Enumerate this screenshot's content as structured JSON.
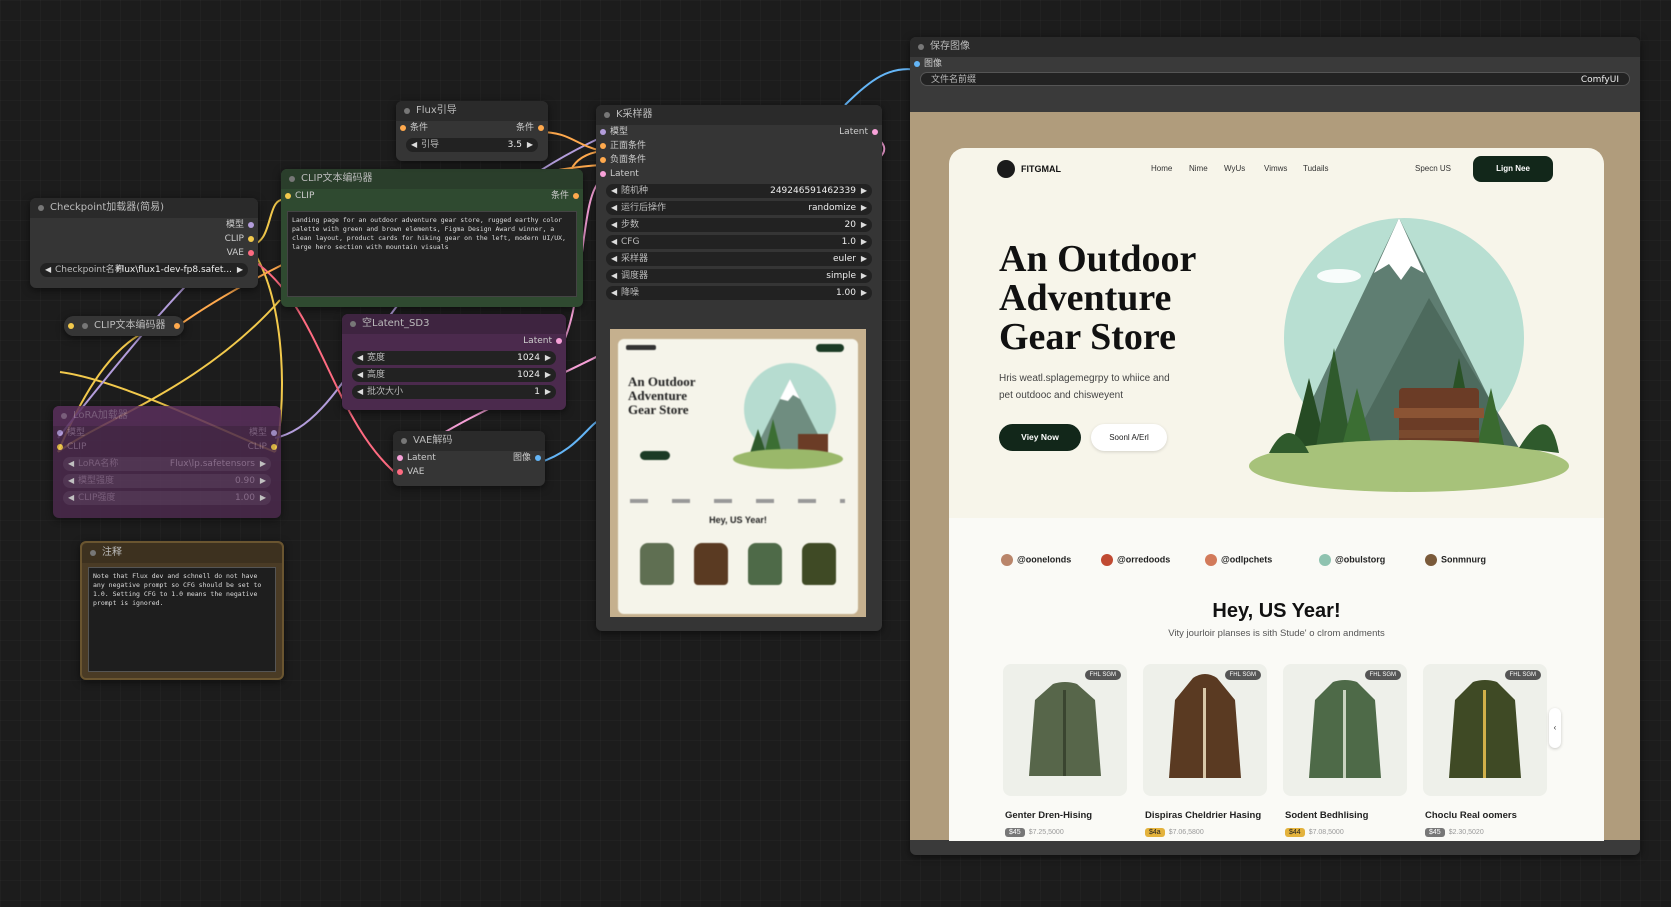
{
  "colors": {
    "clip_green": "#2f4a30",
    "purple": "#4b2a4d",
    "note_brown": "#4a3b25",
    "canvas": "#1c1c1c",
    "clip_wire": "#f2c94c",
    "model_wire": "#b39ddb",
    "vae_wire": "#ff6b81",
    "cond_wire": "#ffa94d",
    "image_wire": "#64b5f6",
    "latent_wire": "#f7a1d8"
  },
  "nodes": {
    "checkpoint": {
      "title": "Checkpoint加载器(简易)",
      "outputs": [
        "模型",
        "CLIP",
        "VAE"
      ],
      "widget_label": "Checkpoint名称",
      "widget_value": "Flux\\flux1-dev-fp8.safet..."
    },
    "clip_neg": {
      "title": "CLIP文本编码器"
    },
    "lora": {
      "title": "LoRA加载器",
      "inputs": [
        "模型",
        "CLIP"
      ],
      "outputs": [
        "模型",
        "CLIP"
      ],
      "widgets": [
        {
          "label": "LoRA名称",
          "value": "Flux\\lp.safetensors"
        },
        {
          "label": "模型强度",
          "value": "0.90"
        },
        {
          "label": "CLIP强度",
          "value": "1.00"
        }
      ]
    },
    "note": {
      "title": "注释",
      "text": "Note that Flux dev and schnell do not have any negative prompt so CFG should be set to 1.0. Setting CFG to 1.0 means the negative prompt is ignored."
    },
    "clip_pos": {
      "title": "CLIP文本编码器",
      "input": "CLIP",
      "output": "条件",
      "prompt": "Landing page for an outdoor adventure gear store, rugged earthy color palette with green and brown elements, Figma Design Award winner, a clean layout, product cards for hiking gear on the left, modern UI/UX, large hero section with mountain visuals"
    },
    "flux_guide": {
      "title": "Flux引导",
      "input": "条件",
      "output": "条件",
      "widget_label": "引导",
      "widget_value": "3.5"
    },
    "empty_latent": {
      "title": "空Latent_SD3",
      "output": "Latent",
      "widgets": [
        {
          "label": "宽度",
          "value": "1024"
        },
        {
          "label": "高度",
          "value": "1024"
        },
        {
          "label": "批次大小",
          "value": "1"
        }
      ]
    },
    "vae_decode": {
      "title": "VAE解码",
      "inputs": [
        "Latent",
        "VAE"
      ],
      "output": "图像"
    },
    "ksampler": {
      "title": "K采样器",
      "inputs": [
        "模型",
        "正面条件",
        "负面条件",
        "Latent"
      ],
      "output": "Latent",
      "widgets": [
        {
          "label": "随机种",
          "value": "249246591462339"
        },
        {
          "label": "运行后操作",
          "value": "randomize"
        },
        {
          "label": "步数",
          "value": "20"
        },
        {
          "label": "CFG",
          "value": "1.0"
        },
        {
          "label": "采样器",
          "value": "euler"
        },
        {
          "label": "调度器",
          "value": "simple"
        },
        {
          "label": "降噪",
          "value": "1.00"
        }
      ]
    },
    "save": {
      "title": "保存图像",
      "input": "图像",
      "widget_label": "文件名前缀",
      "widget_value": "ComfyUI"
    }
  },
  "site": {
    "logo": "FITGMAL",
    "nav": [
      "Home",
      "Nime",
      "WyUs",
      "Vimws",
      "Tudails"
    ],
    "nav_right": "Specn US",
    "cta_button": "Lign Nee",
    "hero_title": [
      "An Outdoor",
      "Adventure",
      "Gear Store"
    ],
    "hero_sub": [
      "Hris weatl.splagemegrpy to whiice and",
      "pet outdooc and chisweyent"
    ],
    "btn_primary": "Viey Now",
    "btn_secondary": "Soonl A/Erl",
    "socials": [
      "@oonelonds",
      "@orredoods",
      "@odlpchets",
      "@obulstorg",
      "Sonmnurg"
    ],
    "section_title": "Hey, US Year!",
    "section_sub": "Vity jourloir planses is sith Stude' o clrom andments",
    "products": [
      {
        "badge": "FHL SGM",
        "name": "Genter Dren-Hising",
        "price": "$45",
        "old": "$7.25,5000"
      },
      {
        "badge": "FHL SGM",
        "name": "Dispiras Cheldrier Hasing",
        "price": "$4a",
        "old": "$7.06,5800"
      },
      {
        "badge": "FHL SGM",
        "name": "Sodent Bedhlising",
        "price": "$44",
        "old": "$7.08,5000"
      },
      {
        "badge": "FHL SGM",
        "name": "Choclu Real oomers",
        "price": "$45",
        "old": "$2.30,5020"
      }
    ]
  },
  "thumb": {
    "hero_title": [
      "An Outdoor",
      "Adventure",
      "Gear Store"
    ],
    "section_title": "Hey, US Year!"
  }
}
